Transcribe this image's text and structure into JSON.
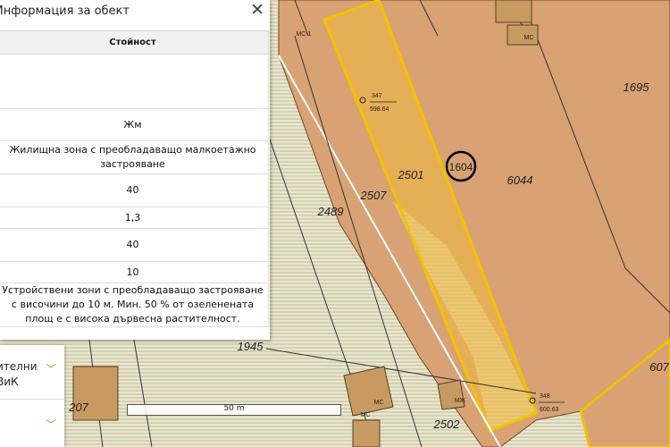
{
  "panel": {
    "title": "Информация за обект",
    "close_icon": "close-icon",
    "column_header": "Стойност",
    "rows": [
      "",
      "Жм",
      "Жилищна зона с преобладаващо малкоетажно застрояване",
      "40",
      "1,3",
      "40",
      "10",
      "Устройствени зони с преобладаващо застрояване с височини до 10 м. Мин. 50 % от озеленената площ е с висока дървесна растителност."
    ]
  },
  "menu": {
    "item_1_line_1": "ителни",
    "item_1_line_2": "ВиК",
    "chevron_icon": "chevron-down-icon"
  },
  "scale": {
    "label": "50 m"
  },
  "map": {
    "parcels": {
      "p1695": "1695",
      "p6044": "6044",
      "p2501": "2501",
      "p2507": "2507",
      "p2489": "2489",
      "p1945": "1945",
      "p2502": "2502",
      "p207": "207",
      "p607": "607",
      "p1604": "1604"
    },
    "buildings": {
      "ms": "МС",
      "mzh": "МЖ",
      "ms1": "МС-1"
    },
    "points": {
      "pt347_no": "347",
      "pt347_h": "598.64",
      "pt348_no": "348",
      "pt348_h": "600.63"
    },
    "colors": {
      "zone_green": "#d6e9c6",
      "hatch_red": "#e9a49a",
      "parcel_brown": "#d8a274",
      "highlight_fill": "#e6b055",
      "highlight_stroke": "#f2c200"
    }
  }
}
